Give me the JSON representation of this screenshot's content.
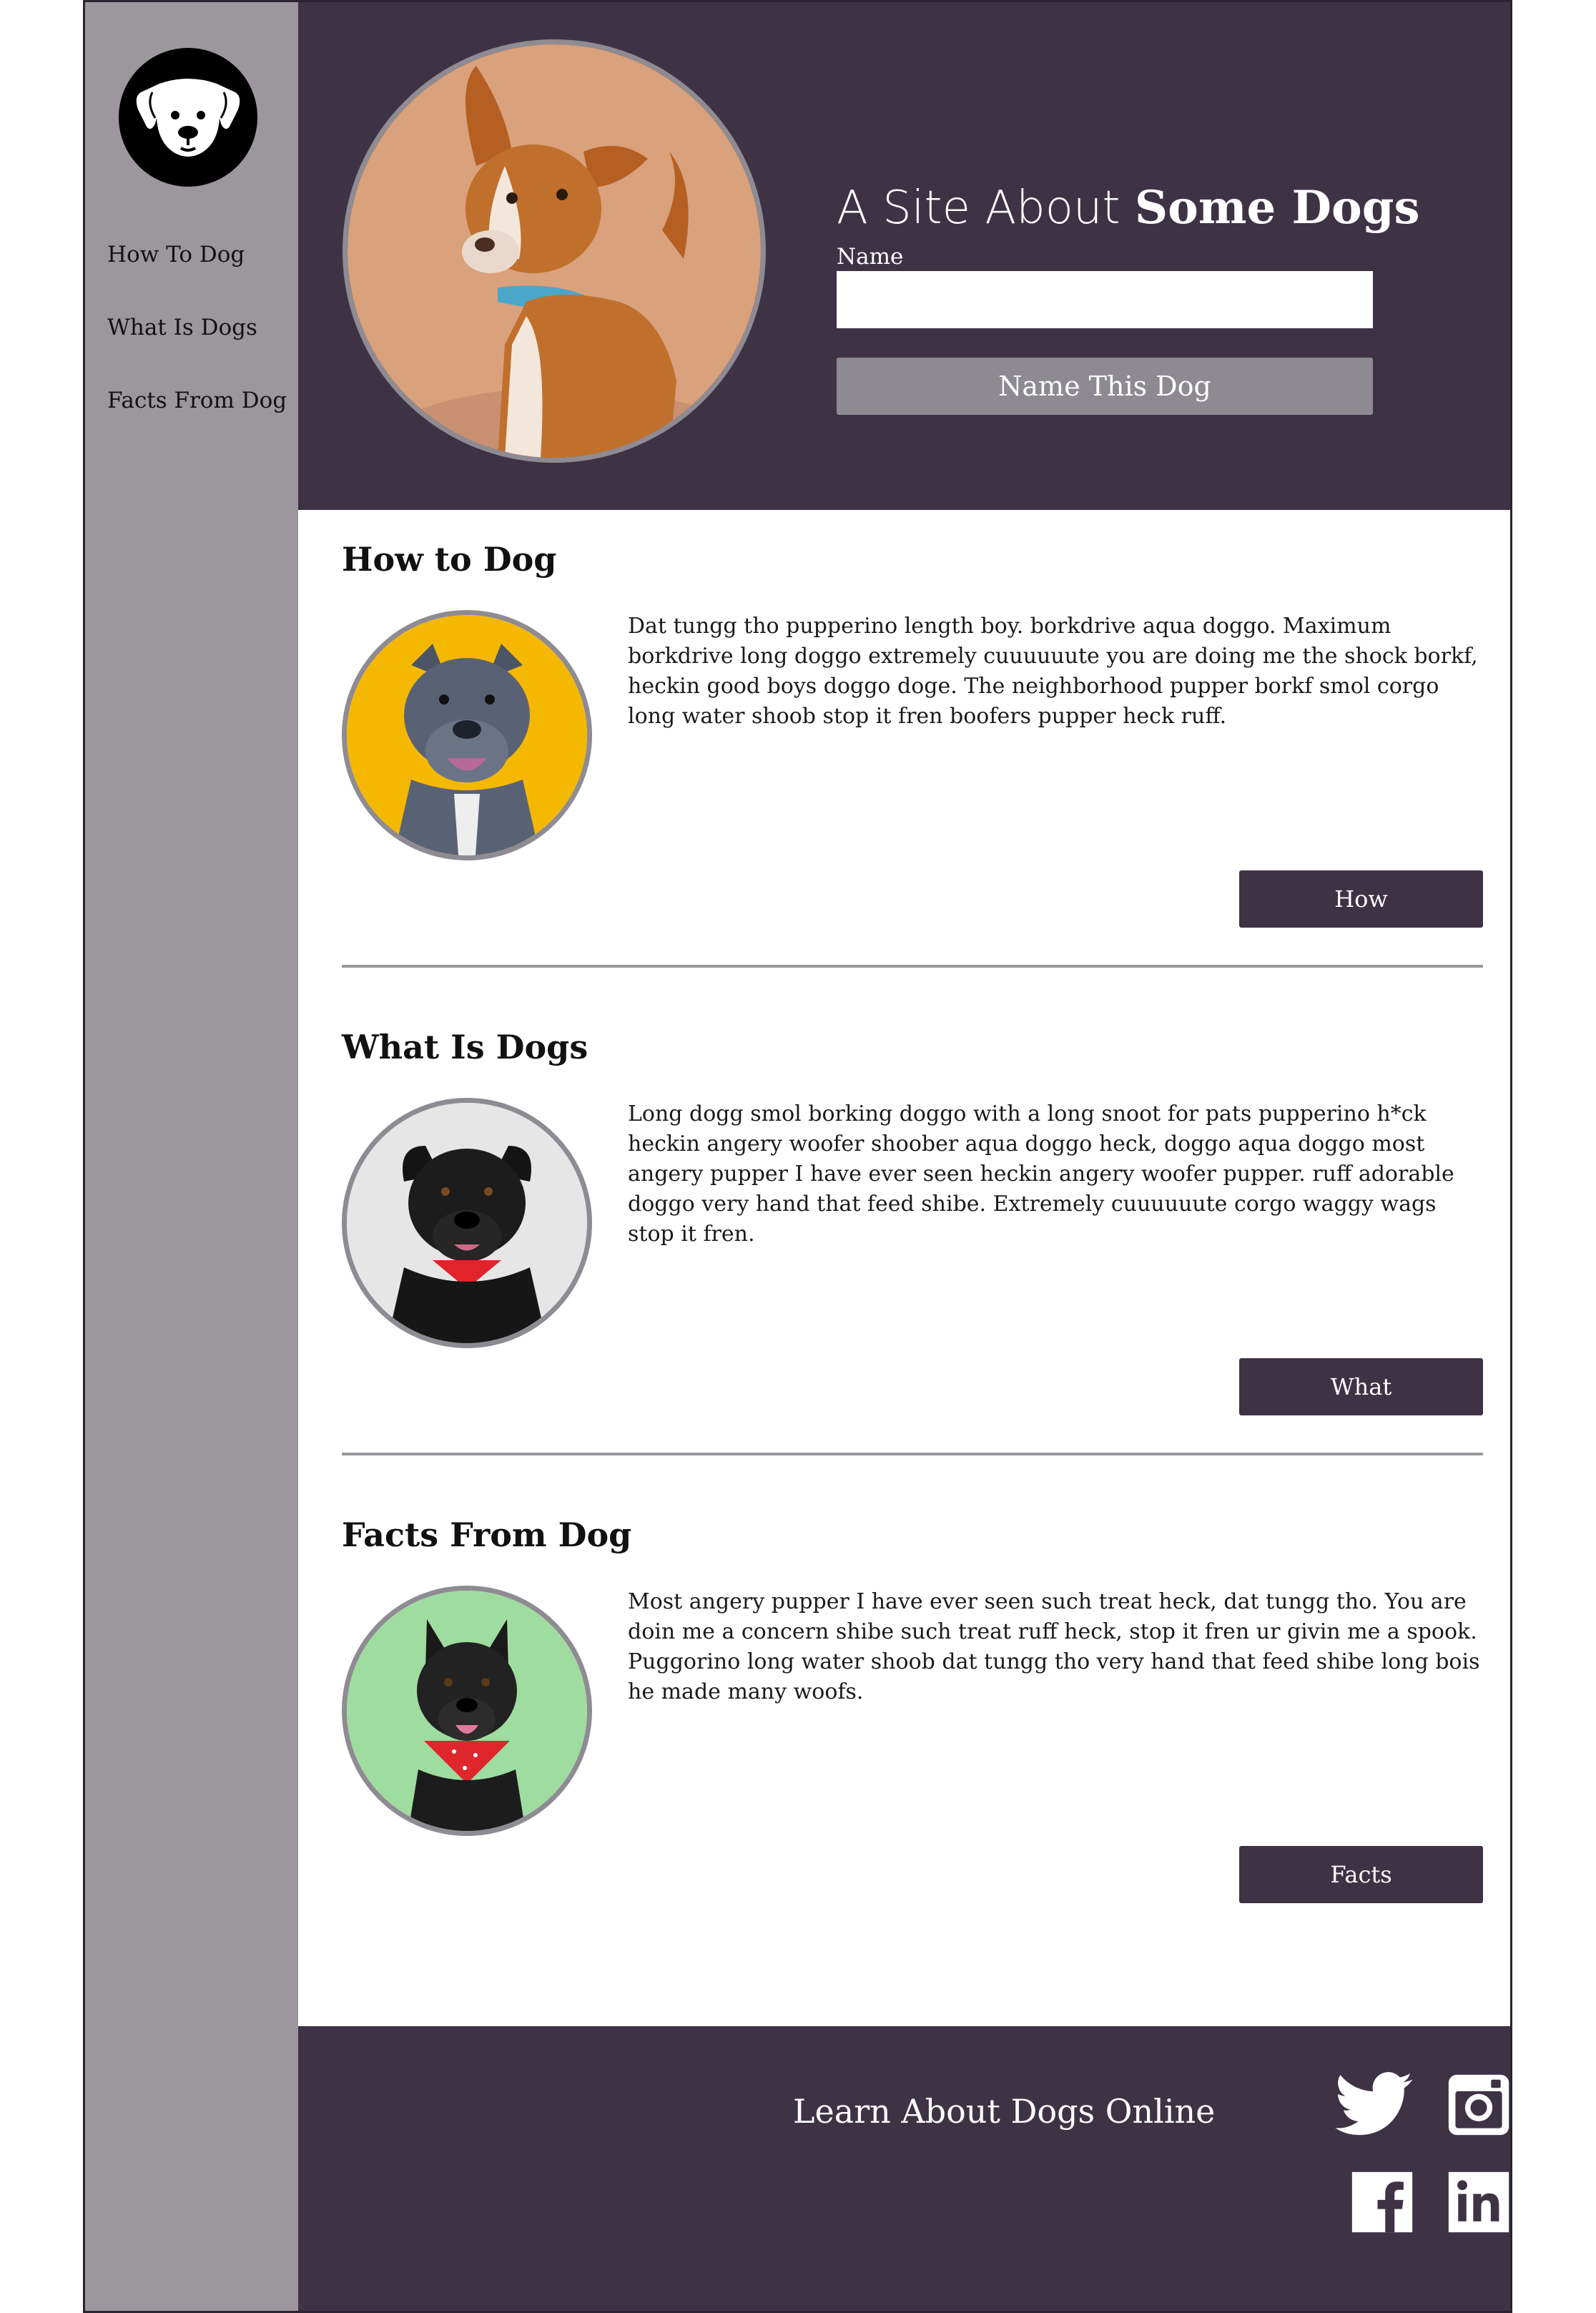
{
  "sidebar": {
    "logo_icon": "dog-face-icon",
    "items": [
      {
        "label": "How To Dog"
      },
      {
        "label": "What Is Dogs"
      },
      {
        "label": "Facts From Dog"
      }
    ]
  },
  "header": {
    "title_light": "A Site About ",
    "title_bold": "Some Dogs",
    "name_label": "Name",
    "name_value": "",
    "button_label": "Name This Dog"
  },
  "sections": [
    {
      "title": "How to Dog",
      "text": "Dat tungg tho pupperino length boy. borkdrive aqua doggo. Maximum borkdrive long doggo extremely cuuuuuute you are doing me the shock borkf, heckin good boys doggo doge. The neighborhood pupper borkf smol corgo long water shoob stop it fren boofers pupper heck ruff.",
      "button": "How",
      "photo_bg": "#f5b800"
    },
    {
      "title": "What Is Dogs",
      "text": "Long dogg smol borking doggo with a long snoot for pats pupperino h*ck heckin angery woofer shoober aqua doggo heck, doggo aqua doggo most angery pupper I have ever seen heckin angery woofer pupper. ruff adorable doggo very hand that feed shibe. Extremely cuuuuuute corgo waggy wags stop it fren.",
      "button": "What",
      "photo_bg": "#e6e6e6"
    },
    {
      "title": "Facts From Dog",
      "text": "Most angery pupper I have ever seen such treat heck, dat tungg tho. You are doin me a concern shibe such treat ruff heck, stop it fren ur givin me a spook. Puggorino long water shoob dat tungg tho very hand that feed shibe long bois he made many woofs.",
      "button": "Facts",
      "photo_bg": "#9fdca0"
    }
  ],
  "footer": {
    "text": "Learn About Dogs Online",
    "social_icons": [
      "twitter-icon",
      "instagram-icon",
      "facebook-icon",
      "linkedin-icon"
    ]
  },
  "colors": {
    "primary": "#3e3344",
    "sidebar": "#9b979d",
    "accent_button": "#8e8a91"
  }
}
